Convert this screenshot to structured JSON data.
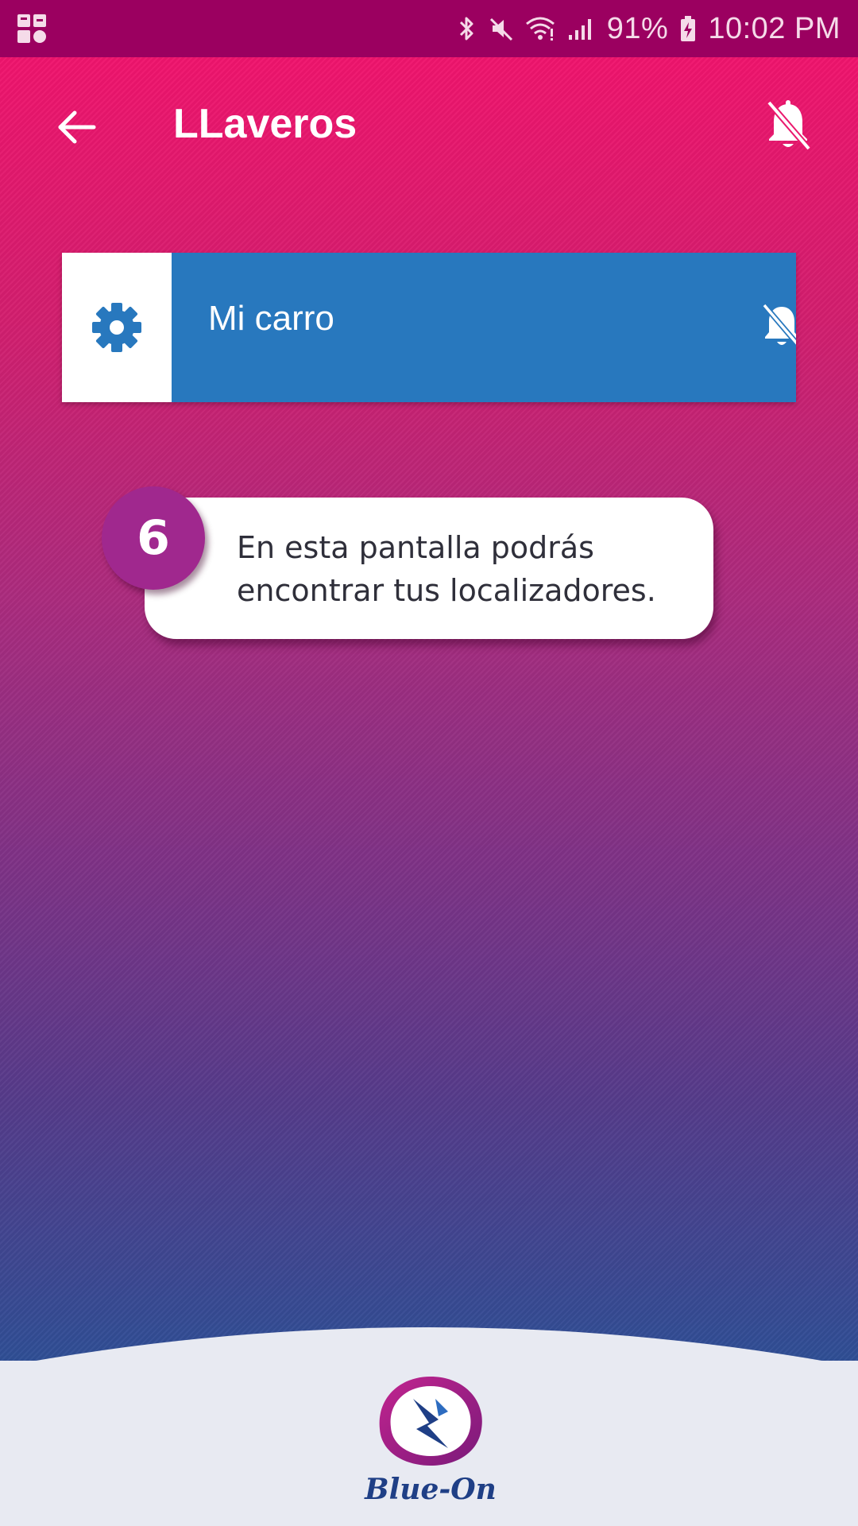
{
  "status_bar": {
    "battery": "91%",
    "time": "10:02 PM",
    "icons": [
      "app-notification-icon",
      "bluetooth-icon",
      "mute-icon",
      "wifi-icon",
      "signal-icon",
      "battery-charging-icon"
    ]
  },
  "header": {
    "title": "LLaveros",
    "back_icon": "arrow-back-icon",
    "notifications_icon": "bell-off-icon"
  },
  "devices": [
    {
      "name": "Mi carro",
      "settings_icon": "gear-icon",
      "notifications_icon": "bell-off-icon"
    }
  ],
  "tutorial": {
    "step": "6",
    "text": "En esta pantalla podrás encontrar tus localizadores."
  },
  "footer": {
    "brand": "Blue-On"
  },
  "colors": {
    "status_bar": "#9b0060",
    "gradient_top": "#f0146d",
    "gradient_bottom": "#2f4e95",
    "card_blue": "#2878be",
    "badge_purple": "#a0288e",
    "footer_bg": "#e8eaf2"
  }
}
